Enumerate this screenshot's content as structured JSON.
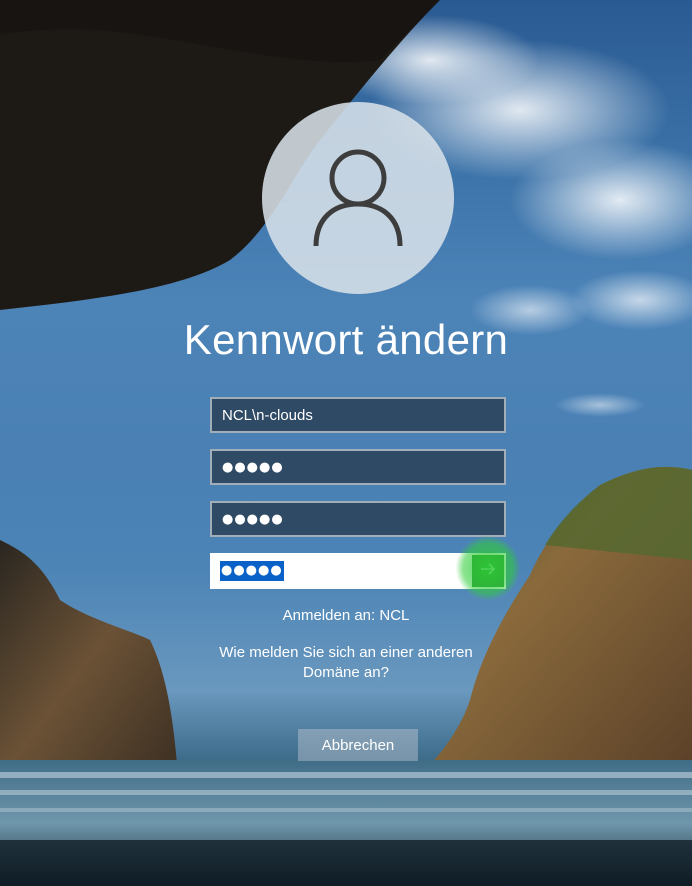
{
  "screen": {
    "title": "Kennwort ändern"
  },
  "fields": {
    "username": {
      "value": "NCL\\n-clouds"
    },
    "old_password": {
      "value": "●●●●●"
    },
    "new_password": {
      "value": "●●●●●"
    },
    "confirm_password": {
      "value": "●●●●●"
    }
  },
  "signin_to": "Anmelden an: NCL",
  "other_domain_line1": "Wie melden Sie sich an einer anderen",
  "other_domain_line2": "Domäne an?",
  "cancel_label": "Abbrechen",
  "icons": {
    "avatar": "user-icon",
    "submit": "arrow-right-icon"
  },
  "colors": {
    "selection": "#0a62c9",
    "submit_button": "#2d8d3a",
    "highlight": "#2ecd36"
  }
}
